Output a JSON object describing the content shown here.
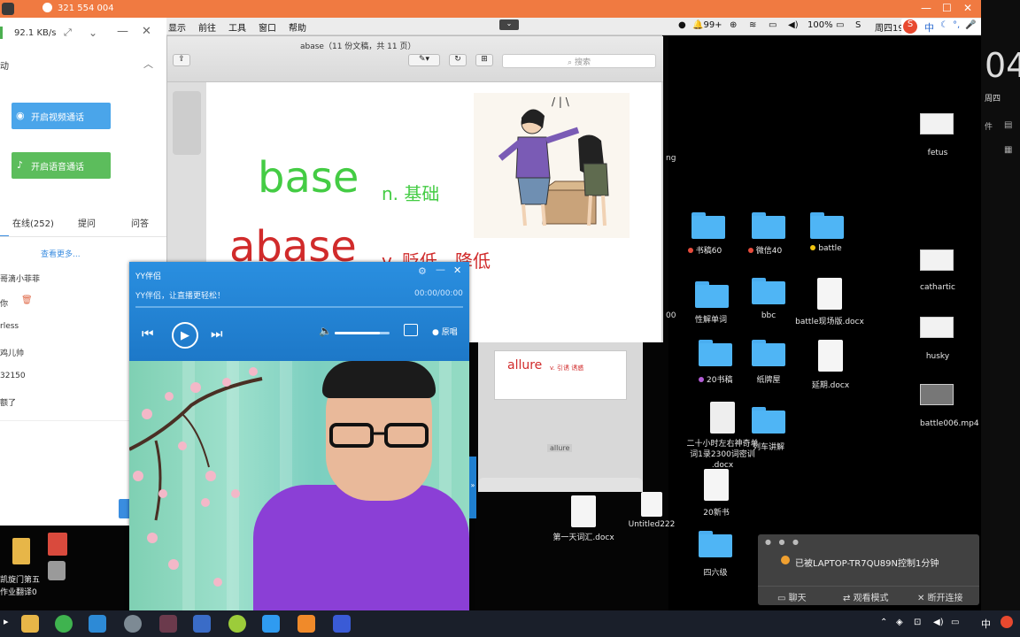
{
  "remote_bar": {
    "id_text": "321 554 004"
  },
  "menubar": {
    "items": [
      "显示",
      "前往",
      "工具",
      "窗口",
      "帮助"
    ],
    "notify_count": "99+",
    "battery": "100%",
    "day": "周四19"
  },
  "ime": {
    "lang": "中"
  },
  "right_strip": {
    "big_num": "04",
    "weekday": "周四",
    "label": "件"
  },
  "left_panel": {
    "speed": "92.1 KB/s",
    "section_label": "动",
    "video_call": "开启视频通话",
    "voice_call": "开启语音通话",
    "tabs": [
      "在线(252)",
      "提问",
      "问答"
    ],
    "see_more": "查看更多...",
    "chat_lines": [
      "哥滴小菲菲",
      "你",
      "rless",
      "鸡儿帅",
      "32150",
      "额了"
    ]
  },
  "pages": {
    "title": "abase（11 份文稿，共 11 页）",
    "search_placeholder": "搜索",
    "word1": "base",
    "word1_pos": "n. 基础",
    "word2": "abase",
    "word2_pos": "v. 贬低，降低",
    "thumb_word": "allure",
    "thumb_sub": "v. 引诱 诱惑",
    "thumb_caption": "allure"
  },
  "yy": {
    "title": "YY伴侣",
    "marquee": "YY伴侣，让直播更轻松！",
    "time": "00:00/00:00",
    "original_label": "原唱",
    "volume_fraction": 0.82
  },
  "desktop": {
    "items": [
      {
        "label": "书稿60",
        "dot": "#e74c3c"
      },
      {
        "label": "微信40",
        "dot": "#e74c3c"
      },
      {
        "label": "battle",
        "dot": "#f1c40f"
      },
      {
        "label": "性解单词"
      },
      {
        "label": "bbc"
      },
      {
        "label": "battle现场版.docx"
      },
      {
        "label": "20书稿",
        "dot": "#b35cd6"
      },
      {
        "label": "纸牌屋"
      },
      {
        "label": "延期.docx"
      },
      {
        "label": "二十小时左右神奇单词1录2300词密训 .docx"
      },
      {
        "label": "列车讲解"
      },
      {
        "label": "20新书"
      },
      {
        "label": "四六级"
      },
      {
        "label": "第一天词汇.docx"
      },
      {
        "label": "Untitled222"
      },
      {
        "label": "fetus"
      },
      {
        "label": "cathartic"
      },
      {
        "label": "husky"
      },
      {
        "label": "battle006.mp4"
      }
    ],
    "side_fragments": [
      "ng",
      "00"
    ]
  },
  "notification": {
    "message": "已被LAPTOP-TR7QU89N控制1分钟",
    "actions": [
      "聊天",
      "观看模式",
      "断开连接"
    ]
  },
  "taskbar": {
    "left_labels": [
      "凯旋门第五",
      "作业翻译0"
    ],
    "tray_lang": "中"
  },
  "colors": {
    "remote_bar": "#f07a41",
    "folder": "#4fb5f5",
    "yy_blue": "#1f7fd0"
  }
}
